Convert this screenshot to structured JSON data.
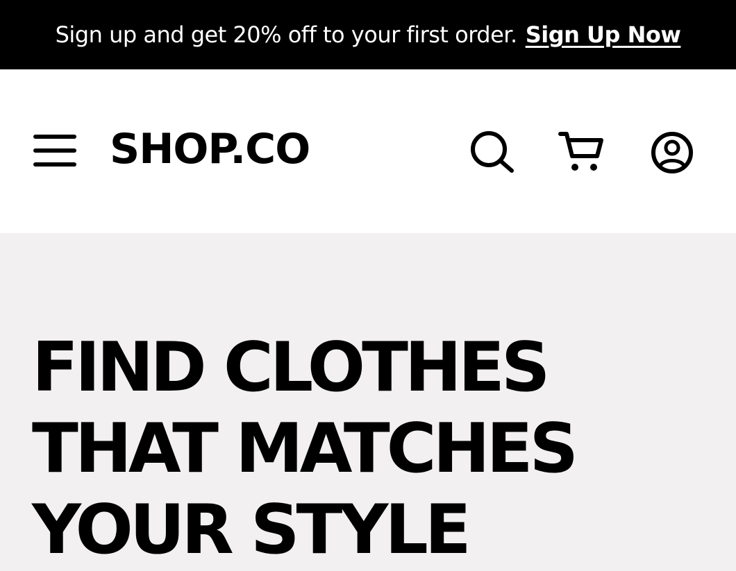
{
  "promo": {
    "text": "Sign up and get 20% off to your first order.",
    "link_label": "Sign Up Now"
  },
  "header": {
    "logo": "SHOP.CO",
    "icons": {
      "menu": "hamburger-menu-icon",
      "search": "search-icon",
      "cart": "cart-icon",
      "account": "account-icon"
    }
  },
  "hero": {
    "title_lines": [
      "FIND CLOTHES",
      "THAT MATCHES",
      "YOUR STYLE"
    ]
  },
  "colors": {
    "promo_background": "#000000",
    "header_background": "#ffffff",
    "hero_background": "#f2f0f1",
    "text": "#000000"
  }
}
